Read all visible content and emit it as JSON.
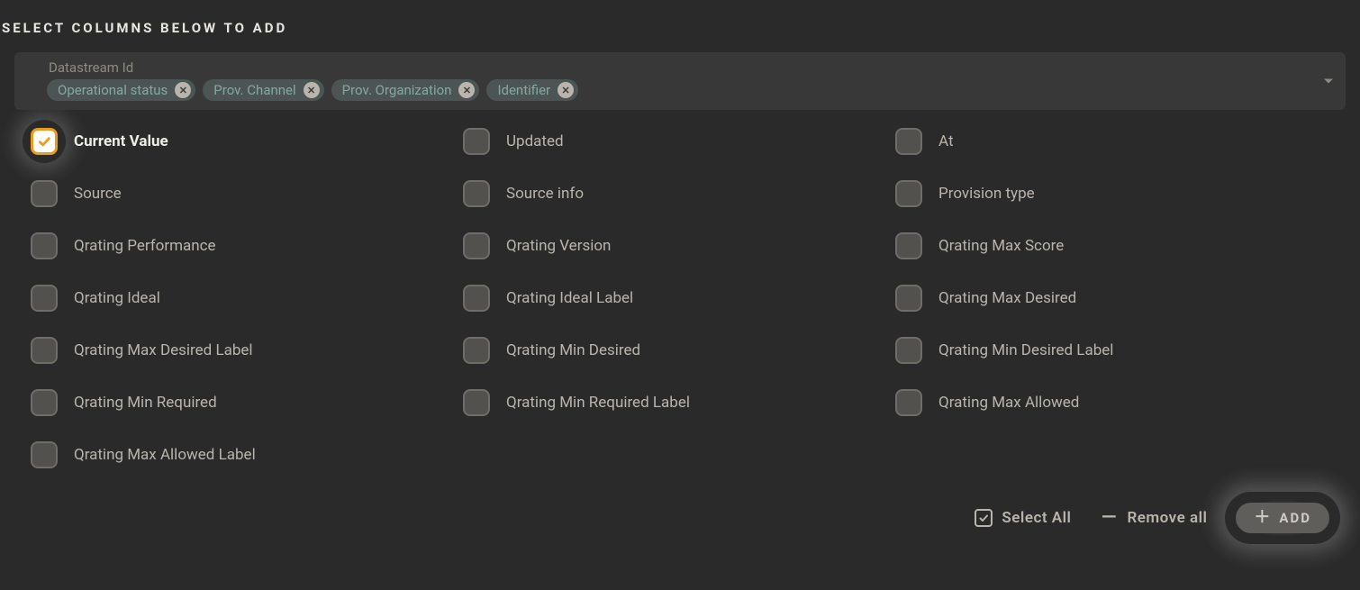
{
  "title": "SELECT COLUMNS BELOW TO ADD",
  "tags": {
    "label": "Datastream Id",
    "items": [
      {
        "label": "Operational status"
      },
      {
        "label": "Prov. Channel"
      },
      {
        "label": "Prov. Organization"
      },
      {
        "label": "Identifier"
      }
    ]
  },
  "options": [
    {
      "label": "Current Value",
      "checked": true
    },
    {
      "label": "Updated",
      "checked": false
    },
    {
      "label": "At",
      "checked": false
    },
    {
      "label": "Source",
      "checked": false
    },
    {
      "label": "Source info",
      "checked": false
    },
    {
      "label": "Provision type",
      "checked": false
    },
    {
      "label": "Qrating Performance",
      "checked": false
    },
    {
      "label": "Qrating Version",
      "checked": false
    },
    {
      "label": "Qrating Max Score",
      "checked": false
    },
    {
      "label": "Qrating Ideal",
      "checked": false
    },
    {
      "label": "Qrating Ideal Label",
      "checked": false
    },
    {
      "label": "Qrating Max Desired",
      "checked": false
    },
    {
      "label": "Qrating Max Desired Label",
      "checked": false
    },
    {
      "label": "Qrating Min Desired",
      "checked": false
    },
    {
      "label": "Qrating Min Desired Label",
      "checked": false
    },
    {
      "label": "Qrating Min Required",
      "checked": false
    },
    {
      "label": "Qrating Min Required Label",
      "checked": false
    },
    {
      "label": "Qrating Max Allowed",
      "checked": false
    },
    {
      "label": "Qrating Max Allowed Label",
      "checked": false
    }
  ],
  "actions": {
    "select_all": "Select All",
    "remove_all": "Remove all",
    "add": "ADD"
  },
  "colors": {
    "accent": "#ea9a1f"
  }
}
